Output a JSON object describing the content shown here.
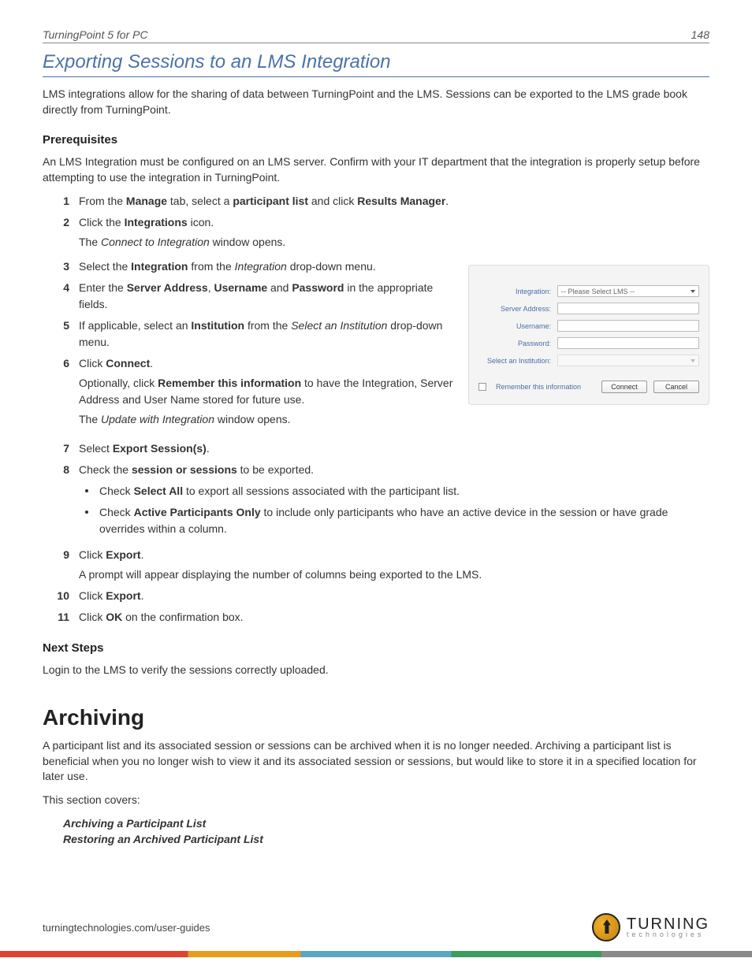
{
  "header": {
    "doc_title": "TurningPoint 5 for PC",
    "page_no": "148"
  },
  "section1": {
    "title": "Exporting Sessions to an LMS Integration",
    "intro": "LMS integrations allow for the sharing of data between TurningPoint and the LMS. Sessions can be exported to the LMS grade book directly from TurningPoint.",
    "prereq_head": "Prerequisites",
    "prereq_text": "An LMS Integration must be configured on an LMS server. Confirm with your IT department that the integration is properly setup before attempting to use the integration in TurningPoint."
  },
  "steps": {
    "s1a": "From the ",
    "s1b": "Manage",
    "s1c": " tab, select a ",
    "s1d": "participant list",
    "s1e": " and click ",
    "s1f": "Results Manager",
    "s1g": ".",
    "s2a": "Click the ",
    "s2b": "Integrations",
    "s2c": " icon.",
    "s2d": "The ",
    "s2e": "Connect to Integration",
    "s2f": " window opens.",
    "s3a": "Select the ",
    "s3b": "Integration",
    "s3c": " from the ",
    "s3d": "Integration",
    "s3e": " drop-down menu.",
    "s4a": "Enter the ",
    "s4b": "Server Address",
    "s4c": ", ",
    "s4d": "Username",
    "s4e": " and ",
    "s4f": "Password",
    "s4g": " in the appropriate fields.",
    "s5a": "If applicable, select an ",
    "s5b": "Institution",
    "s5c": " from the ",
    "s5d": "Select an Institution",
    "s5e": " drop-down menu.",
    "s6a": "Click ",
    "s6b": "Connect",
    "s6c": ".",
    "s6d": "Optionally, click ",
    "s6e": "Remember this information",
    "s6f": " to have the Integration, Server Address and User Name stored for future use.",
    "s6g": "The ",
    "s6h": "Update with Integration",
    "s6i": " window opens.",
    "s7a": "Select ",
    "s7b": "Export Session(s)",
    "s7c": ".",
    "s8a": "Check the ",
    "s8b": "session or sessions",
    "s8c": " to be exported.",
    "s8ba": "Check ",
    "s8bb": "Select All",
    "s8bc": " to export all sessions associated with the participant list.",
    "s8ca": "Check ",
    "s8cb": "Active Participants Only",
    "s8cc": " to include only participants who have an active device in the session or have grade overrides within a column.",
    "s9a": "Click ",
    "s9b": "Export",
    "s9c": ".",
    "s9d": "A prompt will appear displaying the number of columns being exported to the LMS.",
    "s10a": "Click ",
    "s10b": "Export",
    "s10c": ".",
    "s11a": "Click ",
    "s11b": "OK",
    "s11c": " on the confirmation box.",
    "n1": "1",
    "n2": "2",
    "n3": "3",
    "n4": "4",
    "n5": "5",
    "n6": "6",
    "n7": "7",
    "n8": "8",
    "n9": "9",
    "n10": "10",
    "n11": "11"
  },
  "next": {
    "head": "Next Steps",
    "text": "Login to the LMS to verify the sessions correctly uploaded."
  },
  "section2": {
    "title": "Archiving",
    "para": "A participant list and its associated session or sessions can be archived when it is no longer needed. Archiving a participant list is beneficial when you no longer wish to view it and its associated session or sessions, but would like to store it in a specified location for later use.",
    "covers": "This section covers:",
    "link1": "Archiving a Participant List",
    "link2": "Restoring an Archived Participant List"
  },
  "dialog": {
    "integration_label": "Integration:",
    "integration_value": "-- Please Select LMS --",
    "server_label": "Server Address:",
    "user_label": "Username:",
    "pass_label": "Password:",
    "inst_label": "Select an Institution:",
    "remember": "Remember this information",
    "connect": "Connect",
    "cancel": "Cancel"
  },
  "footer": {
    "url": "turningtechnologies.com/user-guides",
    "brand1": "TURNING",
    "brand2": "technologies"
  }
}
